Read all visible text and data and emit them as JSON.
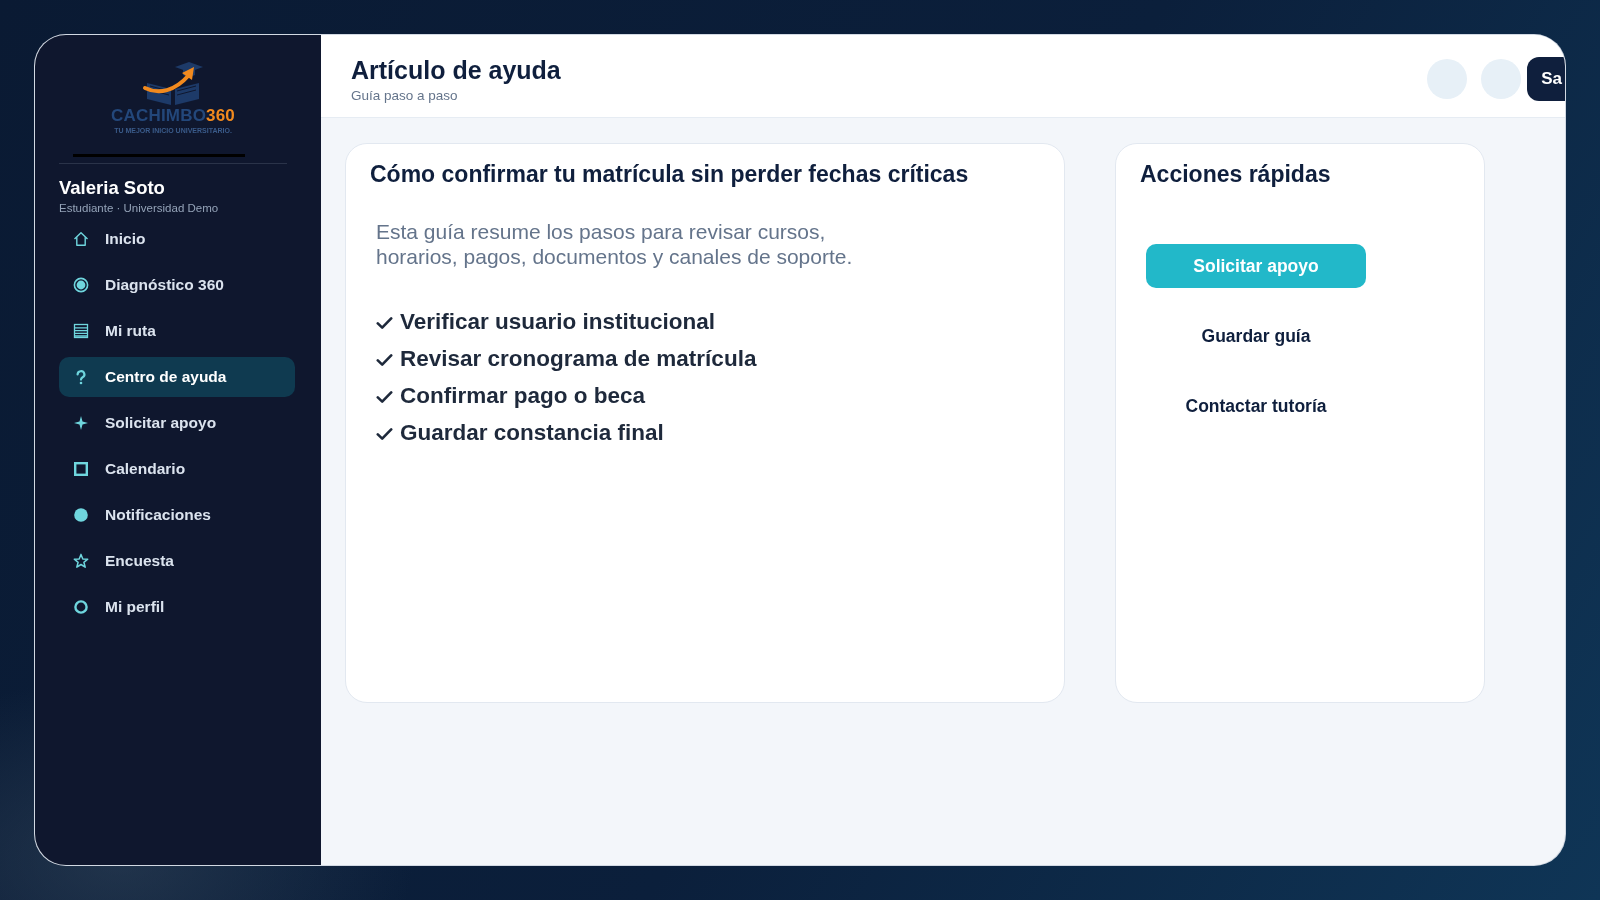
{
  "logo": {
    "wordmark": "CACHIMBO",
    "wordmark_accent": "360",
    "tagline": "TU MEJOR INICIO UNIVERSITARIO."
  },
  "user": {
    "name": "Valeria Soto",
    "role": "Estudiante · Universidad Demo"
  },
  "sidebar": {
    "items": [
      {
        "label": "Inicio",
        "selected": false
      },
      {
        "label": "Diagnóstico 360",
        "selected": false
      },
      {
        "label": "Mi ruta",
        "selected": false
      },
      {
        "label": "Centro de ayuda",
        "selected": true
      },
      {
        "label": "Solicitar apoyo",
        "selected": false
      },
      {
        "label": "Calendario",
        "selected": false
      },
      {
        "label": "Notificaciones",
        "selected": false
      },
      {
        "label": "Encuesta",
        "selected": false
      },
      {
        "label": "Mi perfil",
        "selected": false
      }
    ]
  },
  "header": {
    "title": "Artículo de ayuda",
    "subtitle": "Guía paso a paso",
    "button": "Sa"
  },
  "article": {
    "title": "Cómo confirmar tu matrícula sin perder fechas críticas",
    "intro": "Esta guía resume los pasos para revisar cursos, horarios, pagos, documentos y canales de soporte.",
    "checklist": [
      {
        "label": "Verificar usuario institucional",
        "done": true
      },
      {
        "label": "Revisar cronograma de matrícula",
        "done": true
      },
      {
        "label": "Confirmar pago o beca",
        "done": true
      },
      {
        "label": "Guardar constancia final",
        "done": true
      }
    ]
  },
  "quick_actions": {
    "title": "Acciones rápidas",
    "actions": [
      {
        "label": "Solicitar apoyo",
        "kind": "primary"
      },
      {
        "label": "Guardar guía",
        "kind": "plain"
      },
      {
        "label": "Contactar tutoría",
        "kind": "plain"
      }
    ]
  }
}
